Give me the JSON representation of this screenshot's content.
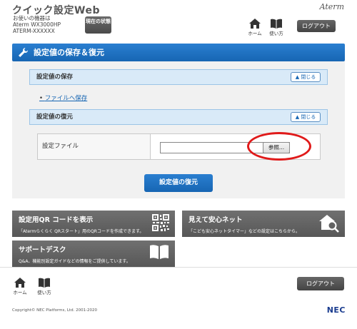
{
  "header": {
    "app_title": "クイック設定Web",
    "device_lines": [
      "お使いの機器は",
      "Aterm WX3000HP",
      "ATERM-XXXXXX"
    ],
    "status_button": "現在の状態",
    "brand": "Aterm",
    "home_label": "ホーム",
    "manual_label": "使い方",
    "logout_label": "ログアウト"
  },
  "panel": {
    "title": "設定値の保存＆復元",
    "save_section": {
      "title": "設定値の保存",
      "close_label": "閉じる",
      "link": "ファイルへ保存"
    },
    "restore_section": {
      "title": "設定値の復元",
      "close_label": "閉じる",
      "file_label": "設定ファイル",
      "file_value": "",
      "browse_label": "参照..."
    },
    "restore_button": "設定値の復元"
  },
  "tiles": [
    {
      "title": "設定用QR コードを表示",
      "desc": "「Atermらくらく QRスタート」用のQRコードを作成できます。",
      "icon": "qr-code-icon"
    },
    {
      "title": "見えて安心ネット",
      "desc": "「こども安心ネットタイマー」などの設定はこちらから。",
      "icon": "home-search-icon"
    },
    {
      "title": "サポートデスク",
      "desc": "Q&A、機能別設定ガイドなどの情報をご提供しています。",
      "icon": "book-icon"
    }
  ],
  "footer": {
    "home_label": "ホーム",
    "manual_label": "使い方",
    "logout_label": "ログアウト",
    "copyright": "Copyright© NEC Platforms, Ltd. 2001-2020",
    "brand": "NEC"
  },
  "colors": {
    "accent_blue": "#1766b3",
    "section_bg": "#d9eaf8",
    "tile_gray": "#626262",
    "highlight_red": "#e01a1a"
  }
}
